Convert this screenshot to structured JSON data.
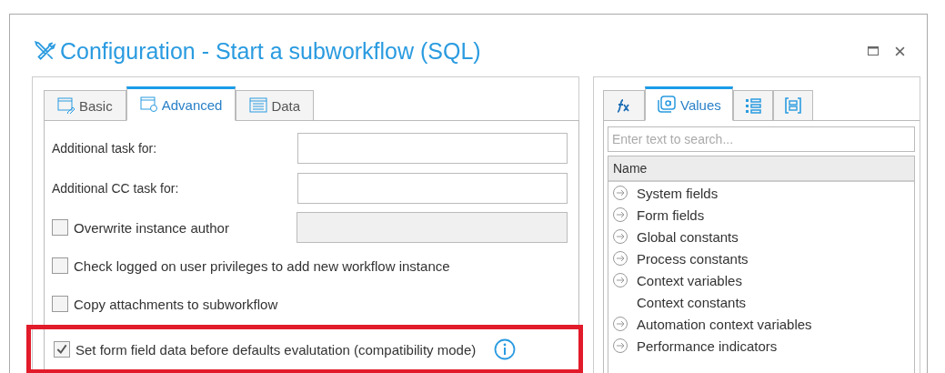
{
  "window": {
    "title": "Configuration - Start a subworkflow (SQL)"
  },
  "left_tabs": [
    {
      "label": "Basic",
      "selected": false
    },
    {
      "label": "Advanced",
      "selected": true
    },
    {
      "label": "Data",
      "selected": false
    }
  ],
  "fields": [
    {
      "label": "Additional task for:",
      "disabled": false
    },
    {
      "label": "Additional CC task for:",
      "disabled": false
    }
  ],
  "options": [
    {
      "kind": "field",
      "label": "Overwrite instance author",
      "checked": false
    },
    {
      "kind": "plain",
      "label": "Check logged on user privileges to add new workflow instance",
      "checked": false
    },
    {
      "kind": "plain",
      "label": "Copy attachments to subworkflow",
      "checked": false
    }
  ],
  "highlighted_options": [
    {
      "kind": "info",
      "label": "Set form field data before defaults evalutation (compatibility mode)",
      "checked": true
    }
  ],
  "right_tabs": [
    {
      "kind": "fx",
      "selected": false
    },
    {
      "kind": "values",
      "label": "Values",
      "selected": true
    },
    {
      "kind": "list",
      "selected": false
    },
    {
      "kind": "bracket",
      "selected": false
    }
  ],
  "search": {
    "placeholder": "Enter text to search..."
  },
  "tree": {
    "header": "Name",
    "items": [
      {
        "label": "System fields",
        "expandable": true
      },
      {
        "label": "Form fields",
        "expandable": true
      },
      {
        "label": "Global constants",
        "expandable": true
      },
      {
        "label": "Process constants",
        "expandable": true
      },
      {
        "label": "Context variables",
        "expandable": true
      },
      {
        "label": "Context constants",
        "expandable": false
      },
      {
        "label": "Automation context variables",
        "expandable": true
      },
      {
        "label": "Performance indicators",
        "expandable": true
      }
    ]
  }
}
